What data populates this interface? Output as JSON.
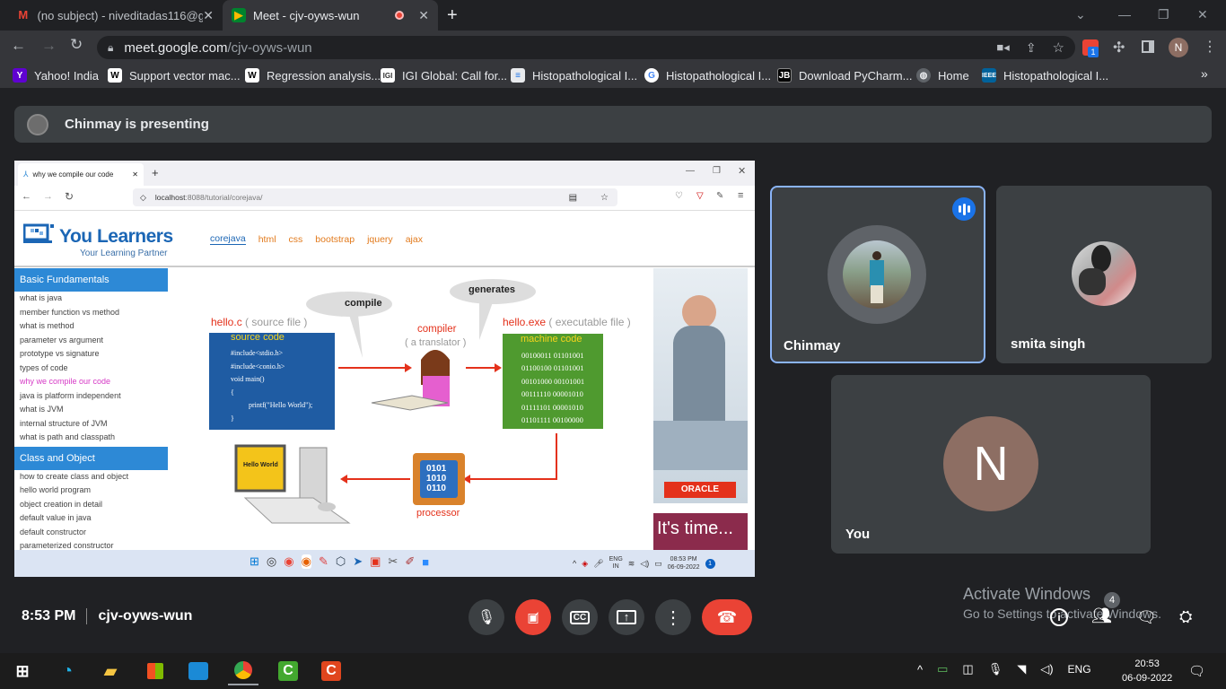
{
  "browser": {
    "tabs": [
      {
        "label": "(no subject) - niveditadas116@gr",
        "icon": "gmail-icon"
      },
      {
        "label": "Meet - cjv-oyws-wun",
        "icon": "meet-icon"
      }
    ],
    "url_host": "meet.google.com",
    "url_path": "/cjv-oyws-wun",
    "profile_initial": "N",
    "extension_badge": "1",
    "bookmarks": [
      {
        "label": "Yahoo! India",
        "icon": "yahoo-icon"
      },
      {
        "label": "Support vector mac...",
        "icon": "wikipedia-icon"
      },
      {
        "label": "Regression analysis...",
        "icon": "wikipedia-icon"
      },
      {
        "label": "IGI Global: Call for...",
        "icon": "igi-icon"
      },
      {
        "label": "Histopathological I...",
        "icon": "doc-icon"
      },
      {
        "label": "Histopathological I...",
        "icon": "google-icon"
      },
      {
        "label": "Download PyCharm...",
        "icon": "jetbrains-icon"
      },
      {
        "label": "Home",
        "icon": "globe-icon"
      },
      {
        "label": "Histopathological I...",
        "icon": "ieee-icon"
      }
    ]
  },
  "meet": {
    "presenting_text": "Chinmay is presenting",
    "participants": [
      {
        "name": "Chinmay",
        "speaking": true
      },
      {
        "name": "smita singh"
      },
      {
        "name": "You",
        "initial": "N"
      }
    ],
    "time": "8:53 PM",
    "meeting_code": "cjv-oyws-wun",
    "people_count": "4",
    "watermark_title": "Activate Windows",
    "watermark_sub": "Go to Settings to activate Windows."
  },
  "shared": {
    "tab_title": "why we compile our code",
    "url_host": "localhost",
    "url_rest": ":8088/tutorial/corejava/",
    "logo_title": "You Learners",
    "logo_sub": "Your Learning Partner",
    "nav": [
      "corejava",
      "html",
      "css",
      "bootstrap",
      "jquery",
      "ajax"
    ],
    "sections": [
      {
        "title": "Basic Fundamentals",
        "items": [
          "what is java",
          "member function vs method",
          "what is method",
          "parameter vs argument",
          "prototype vs signature",
          "types of code",
          "why we compile our code",
          "java is platform independent",
          "what is JVM",
          "internal structure of JVM",
          "what is path and classpath"
        ]
      },
      {
        "title": "Class and Object",
        "items": [
          "how to create class and object",
          "hello world program",
          "object creation in detail",
          "default value in java",
          "default constructor",
          "parameterized constructor"
        ]
      }
    ],
    "diagram": {
      "compile": "compile",
      "generates": "generates",
      "hello_c": "hello.c",
      "source_file": "( source file )",
      "source_code": "source code",
      "code_lines": [
        "#include<stdio.h>",
        "#include<conio.h>",
        "void main()",
        "{",
        "printf(\"Hello World\");",
        "}"
      ],
      "compiler": "compiler",
      "translator": "( a translator )",
      "hello_exe": "hello.exe",
      "exe_file": "( executable file )",
      "machine_code": "machine code",
      "binary": [
        "00100011 01101001",
        "01100100 01101001",
        "00101000 00101001",
        "00111110 00001010",
        "01111101 00001010",
        "01101111 00100000"
      ],
      "processor": "processor",
      "chip": [
        "0101",
        "1010",
        "0110"
      ],
      "monitor": "Hello World"
    },
    "ad_brand": "ORACLE",
    "ad_text": "It's time...",
    "taskbar_time": "08:53 PM",
    "taskbar_date": "06-09-2022",
    "taskbar_lang": "ENG",
    "taskbar_region": "IN"
  },
  "taskbar": {
    "lang": "ENG",
    "time": "20:53",
    "date": "06-09-2022"
  }
}
